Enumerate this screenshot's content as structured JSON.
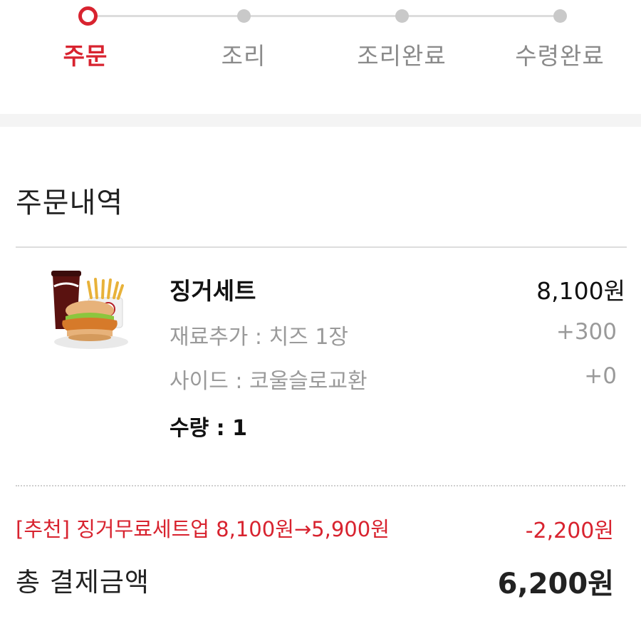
{
  "stepper": {
    "steps": [
      {
        "label": "주문",
        "active": true
      },
      {
        "label": "조리",
        "active": false
      },
      {
        "label": "조리완료",
        "active": false
      },
      {
        "label": "수령완료",
        "active": false
      }
    ],
    "active_color": "#d8232f",
    "inactive_color": "#c9c9c9"
  },
  "order": {
    "title": "주문내역",
    "item": {
      "image_icon": "combo-meal-image",
      "name": "징거세트",
      "price": "8,100원",
      "options": [
        {
          "label": "재료추가 : 치즈 1장",
          "price": "+300"
        },
        {
          "label": "사이드 : 코울슬로교환",
          "price": "+0"
        }
      ],
      "quantity": "수량 : 1"
    },
    "promo": {
      "text": "[추천] 징거무료세트업 8,100원→5,900원",
      "discount": "-2,200원",
      "color": "#d8232f"
    },
    "total": {
      "label": "총 결제금액",
      "value": "6,200원"
    }
  }
}
